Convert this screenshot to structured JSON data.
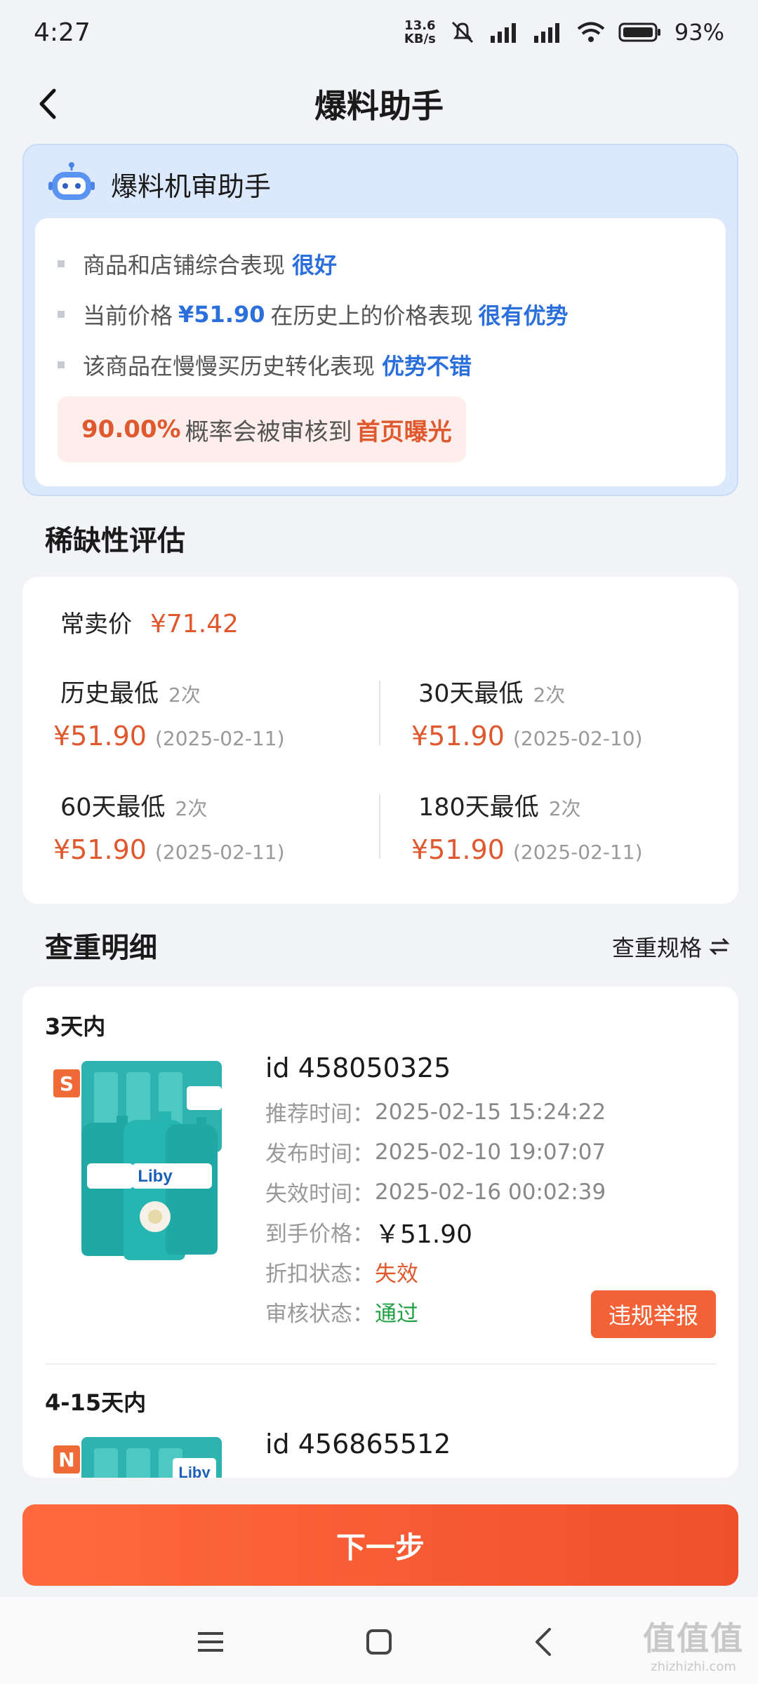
{
  "status_bar": {
    "time": "4:27",
    "net_speed_value": "13.6",
    "net_speed_unit": "KB/s",
    "battery": "93%"
  },
  "header": {
    "title": "爆料助手",
    "back_icon": "chevron-left-icon"
  },
  "review": {
    "title": "爆料机审助手",
    "robot_icon": "robot-icon",
    "items": [
      {
        "text": "商品和店铺综合表现",
        "highlight": "很好"
      },
      {
        "prefix": "当前价格",
        "price": "¥51.90",
        "middle": "在历史上的价格表现",
        "highlight": "很有优势"
      },
      {
        "text": "该商品在慢慢买历史转化表现",
        "highlight": "优势不错"
      }
    ],
    "probability": {
      "value": "90.00%",
      "text": "概率会被审核到",
      "target": "首页曝光"
    }
  },
  "scarcity": {
    "section_title": "稀缺性评估",
    "normal_price_label": "常卖价",
    "normal_price": "¥71.42",
    "stats": [
      {
        "label": "历史最低",
        "times": "2次",
        "price": "¥51.90",
        "date": "(2025-02-11)"
      },
      {
        "label": "30天最低",
        "times": "2次",
        "price": "¥51.90",
        "date": "(2025-02-10)"
      },
      {
        "label": "60天最低",
        "times": "2次",
        "price": "¥51.90",
        "date": "(2025-02-11)"
      },
      {
        "label": "180天最低",
        "times": "2次",
        "price": "¥51.90",
        "date": "(2025-02-11)"
      }
    ]
  },
  "duplicates": {
    "section_title": "查重明细",
    "spec_switch_label": "查重规格",
    "switch_icon": "swap-arrows-icon",
    "groups": [
      {
        "label": "3天内",
        "badge": "S",
        "brand": "Liby",
        "id": "id 458050325",
        "rows": [
          {
            "key": "推荐时间：",
            "value": "2025-02-15 15:24:22"
          },
          {
            "key": "发布时间：",
            "value": "2025-02-10 19:07:07"
          },
          {
            "key": "失效时间：",
            "value": "2025-02-16 00:02:39"
          },
          {
            "key": "到手价格：",
            "value": "￥51.90"
          },
          {
            "key": "折扣状态：",
            "value": "失效"
          },
          {
            "key": "审核状态：",
            "value": "通过"
          }
        ],
        "report_label": "违规举报"
      },
      {
        "label": "4-15天内",
        "badge": "N",
        "brand": "Liby",
        "id": "id 456865512"
      }
    ]
  },
  "next_button": "下一步",
  "nav": {
    "menu_icon": "menu-icon",
    "home_icon": "home-square-icon",
    "back_icon": "back-triangle-icon"
  },
  "watermark": {
    "logo": "值值值",
    "text": "zhizhizhi.com"
  },
  "colors": {
    "accent_orange": "#e0582e",
    "accent_blue": "#2a6fdb",
    "success_green": "#21a144",
    "button_orange": "#f26236"
  }
}
